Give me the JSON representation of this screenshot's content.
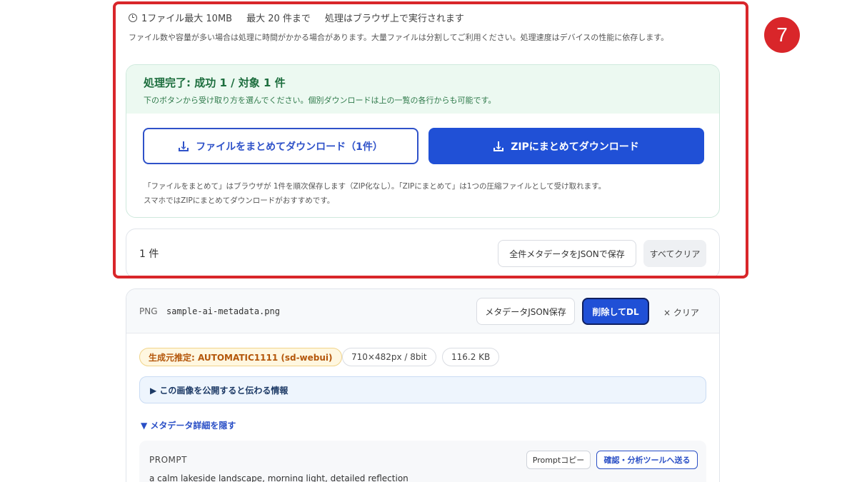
{
  "step_badge": "7",
  "limits": {
    "max_size": "1ファイル最大 10MB",
    "max_count": "最大 20 件まで",
    "browser_note": "処理はブラウザ上で実行されます"
  },
  "notice": "ファイル数や容量が多い場合は処理に時間がかかる場合があります。大量ファイルは分割してご利用ください。処理速度はデバイスの性能に依存します。",
  "done": {
    "title": "処理完了: 成功 1 / 対象 1 件",
    "subtitle": "下のボタンから受け取り方を選んでください。個別ダウンロードは上の一覧の各行からも可能です。",
    "btn_files": "ファイルをまとめてダウンロード（1件）",
    "btn_zip": "ZIPにまとめてダウンロード",
    "help_line1": "「ファイルをまとめて」はブラウザが 1件を順次保存します（ZIP化なし）。「ZIPにまとめて」は1つの圧縮ファイルとして受け取れます。",
    "help_line2": "スマホではZIPにまとめてダウンロードがおすすめです。"
  },
  "summary": {
    "count": "1 件",
    "save_all_json": "全件メタデータをJSONで保存",
    "clear_all": "すべてクリア"
  },
  "file": {
    "type": "PNG",
    "name": "sample-ai-metadata.png",
    "save_json": "メタデータJSON保存",
    "delete_dl": "削除してDL",
    "clear": "× クリア",
    "tag_generator": "生成元推定: AUTOMATIC1111 (sd-webui)",
    "tag_dims": "710×482px / 8bit",
    "tag_size": "116.2 KB",
    "public_info": "▶ この画像を公開すると伝わる情報",
    "hide_details": "▼ メタデータ詳細を隠す",
    "prompt_label": "PROMPT",
    "copy_prompt": "Promptコピー",
    "send_tool": "確認・分析ツールへ送る",
    "prompt_text": "a calm lakeside landscape, morning light, detailed reflection"
  },
  "colors": {
    "highlight": "#d9262a",
    "primary": "#2050d6",
    "success_bg": "#ecf9f1",
    "success_text": "#1d6e3e"
  }
}
